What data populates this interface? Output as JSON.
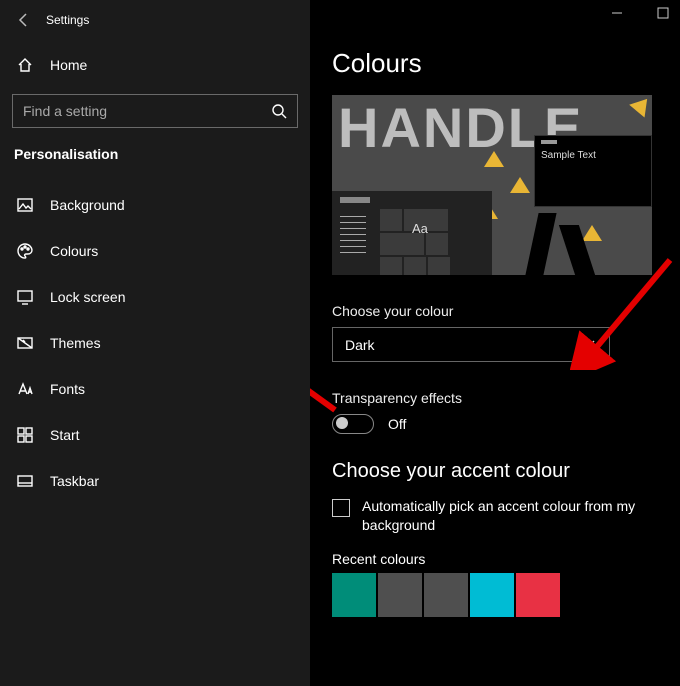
{
  "window": {
    "title": "Settings"
  },
  "sidebar": {
    "home": "Home",
    "search_placeholder": "Find a setting",
    "section": "Personalisation",
    "items": [
      {
        "label": "Background"
      },
      {
        "label": "Colours"
      },
      {
        "label": "Lock screen"
      },
      {
        "label": "Themes"
      },
      {
        "label": "Fonts"
      },
      {
        "label": "Start"
      },
      {
        "label": "Taskbar"
      }
    ]
  },
  "main": {
    "title": "Colours",
    "preview_headline": "HANDLE",
    "sample_text": "Sample Text",
    "sample_aa": "Aa",
    "choose_colour_label": "Choose your colour",
    "choose_colour_value": "Dark",
    "transparency_label": "Transparency effects",
    "transparency_value": "Off",
    "accent_heading": "Choose your accent colour",
    "auto_accent_label": "Automatically pick an accent colour from my background",
    "recent_label": "Recent colours",
    "recent_colours": [
      "#008d79",
      "#4f4f4f",
      "#4f4f4f",
      "#00bcd4",
      "#e83144"
    ]
  }
}
